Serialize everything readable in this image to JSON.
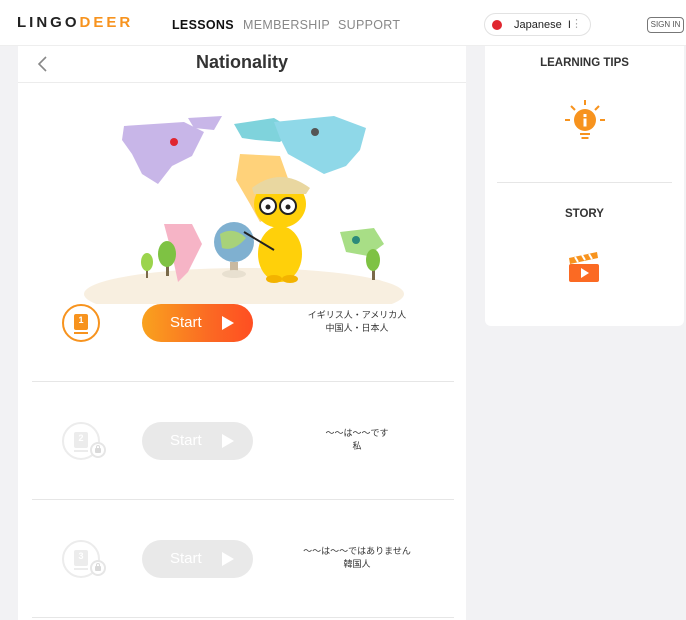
{
  "header": {
    "logo_part1": "LINGO",
    "logo_part2": "DEER",
    "nav": [
      "LESSONS",
      "MEMBERSHIP",
      "SUPPORT"
    ],
    "language": "Japanese",
    "language_cursor": "I",
    "menu_glyph": "⋮",
    "sign_in": "SIGN IN"
  },
  "main": {
    "title": "Nationality",
    "back_icon": "chevron-left-icon",
    "lessons": [
      {
        "number": "1",
        "start_label": "Start",
        "locked": false,
        "lines": [
          "イギリス人・アメリカ人",
          "中国人・日本人"
        ]
      },
      {
        "number": "2",
        "start_label": "Start",
        "locked": true,
        "lines": [
          "～～は～～です",
          "私"
        ]
      },
      {
        "number": "3",
        "start_label": "Start",
        "locked": true,
        "lines": [
          "～～は～～ではありません",
          "韓国人"
        ]
      }
    ]
  },
  "side": {
    "learning_tips": "LEARNING TIPS",
    "story": "STORY",
    "tips_icon": "lightbulb-icon",
    "story_icon": "clapperboard-icon"
  },
  "colors": {
    "accent": "#f7931e",
    "start_gradient_end": "#ff4e22",
    "disabled": "#e9e9e9"
  }
}
